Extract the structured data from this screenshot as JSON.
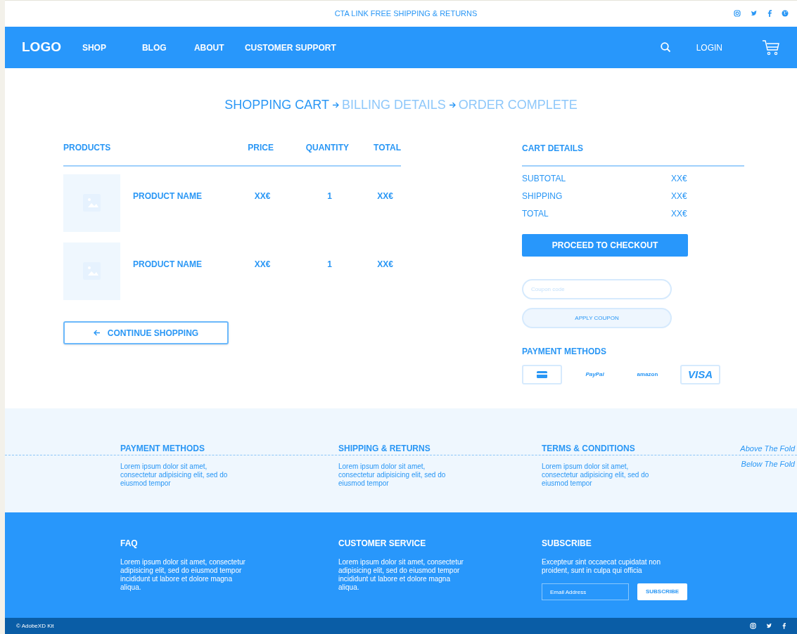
{
  "top_bar": {
    "cta": "CTA LINK FREE SHIPPING & RETURNS"
  },
  "nav": {
    "logo": "LOGO",
    "links": [
      "SHOP",
      "BLOG",
      "ABOUT",
      "CUSTOMER SUPPORT"
    ],
    "login": "LOGIN"
  },
  "steps": [
    {
      "label": "SHOPPING CART",
      "selected": true
    },
    {
      "label": "BILLING DETAILS",
      "selected": false
    },
    {
      "label": "ORDER COMPLETE",
      "selected": false
    }
  ],
  "cart": {
    "columns": [
      "PRODUCTS",
      "PRICE",
      "QUANTITY",
      "TOTAL"
    ],
    "rows": [
      {
        "name": "PRODUCT NAME",
        "price": "XX€",
        "quantity": "1",
        "total": "XX€"
      },
      {
        "name": "PRODUCT NAME",
        "price": "XX€",
        "quantity": "1",
        "total": "XX€"
      }
    ],
    "continue": "CONTINUE SHOPPING"
  },
  "cart_details": {
    "title": "CART DETAILS",
    "lines": [
      {
        "label": "SUBTOTAL",
        "value": "XX€"
      },
      {
        "label": "SHIPPING",
        "value": "XX€"
      },
      {
        "label": "TOTAL",
        "value": "XX€"
      }
    ],
    "checkout": "PROCEED TO CHECKOUT",
    "coupon_placeholder": "Coupon code",
    "apply": "APPLY COUPON",
    "payment_title": "PAYMENT METHODS",
    "payments": [
      {
        "kind": "card",
        "selected": true
      },
      {
        "kind": "paypal",
        "label": "PayPal",
        "selected": false
      },
      {
        "kind": "amazon",
        "label": "amazon",
        "selected": false
      },
      {
        "kind": "visa",
        "label": "VISA",
        "selected": true
      }
    ]
  },
  "info": [
    {
      "title": "PAYMENT METHODS",
      "text": "Lorem ipsum dolor sit amet, consectetur adipisicing elit, sed do eiusmod tempor"
    },
    {
      "title": "SHIPPING & RETURNS",
      "text": "Lorem ipsum dolor sit amet, consectetur adipisicing elit, sed do eiusmod tempor"
    },
    {
      "title": "TERMS & CONDITIONS",
      "text": "Lorem ipsum dolor sit amet, consectetur adipisicing elit, sed do eiusmod tempor"
    }
  ],
  "fold": {
    "above": "Above The Fold",
    "below": "Below The Fold"
  },
  "footer": {
    "columns": [
      {
        "title": "FAQ",
        "text": "Lorem ipsum dolor sit amet, consectetur adipisicing elit, sed do eiusmod tempor incididunt ut labore et dolore magna aliqua."
      },
      {
        "title": "CUSTOMER SERVICE",
        "text": "Lorem ipsum dolor sit amet, consectetur adipisicing elit, sed do eiusmod tempor incididunt ut labore et dolore magna aliqua."
      }
    ],
    "subscribe": {
      "title": "SUBSCRIBE",
      "text": "Excepteur sint occaecat cupidatat non proident, sunt in culpa qui officia",
      "placeholder": "Email Address",
      "button": "SUBSCRIBE"
    },
    "copyright": "© AdobeXD Kit"
  }
}
